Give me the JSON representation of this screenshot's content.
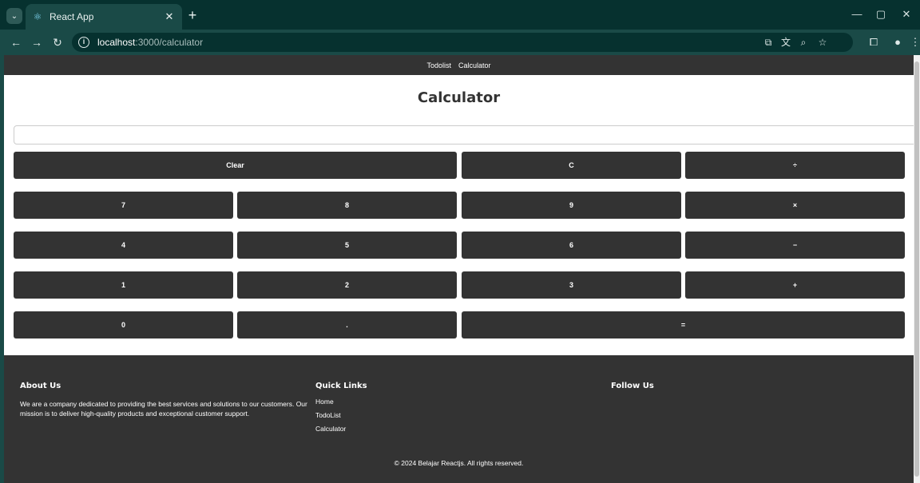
{
  "browser": {
    "tab_title": "React App",
    "url_host": "localhost",
    "url_path": ":3000/calculator"
  },
  "nav": {
    "links": [
      "Todolist",
      "Calculator"
    ]
  },
  "calculator": {
    "title": "Calculator",
    "display_value": "",
    "buttons": {
      "clear": "Clear",
      "c": "C",
      "divide": "÷",
      "seven": "7",
      "eight": "8",
      "nine": "9",
      "multiply": "×",
      "four": "4",
      "five": "5",
      "six": "6",
      "minus": "−",
      "one": "1",
      "two": "2",
      "three": "3",
      "plus": "+",
      "zero": "0",
      "dot": ".",
      "equals": "="
    },
    "button_color": "#333333"
  },
  "footer": {
    "about_heading": "About Us",
    "about_text": "We are a company dedicated to providing the best services and solutions to our customers. Our mission is to deliver high-quality products and exceptional customer support.",
    "links_heading": "Quick Links",
    "links": [
      "Home",
      "TodoList",
      "Calculator"
    ],
    "follow_heading": "Follow Us",
    "copyright": "© 2024 Belajar Reactjs. All rights reserved."
  },
  "icons": {
    "tab_menu": "chevron-down-icon",
    "favicon": "react-icon",
    "back": "back-arrow-icon",
    "forward": "forward-arrow-icon",
    "reload": "reload-icon",
    "site_info": "info-icon",
    "cast": "cast-icon",
    "translate": "translate-icon",
    "zoom": "zoom-icon",
    "bookmark": "star-icon",
    "extensions": "puzzle-icon",
    "profile": "profile-icon",
    "menu": "kebab-menu-icon"
  }
}
